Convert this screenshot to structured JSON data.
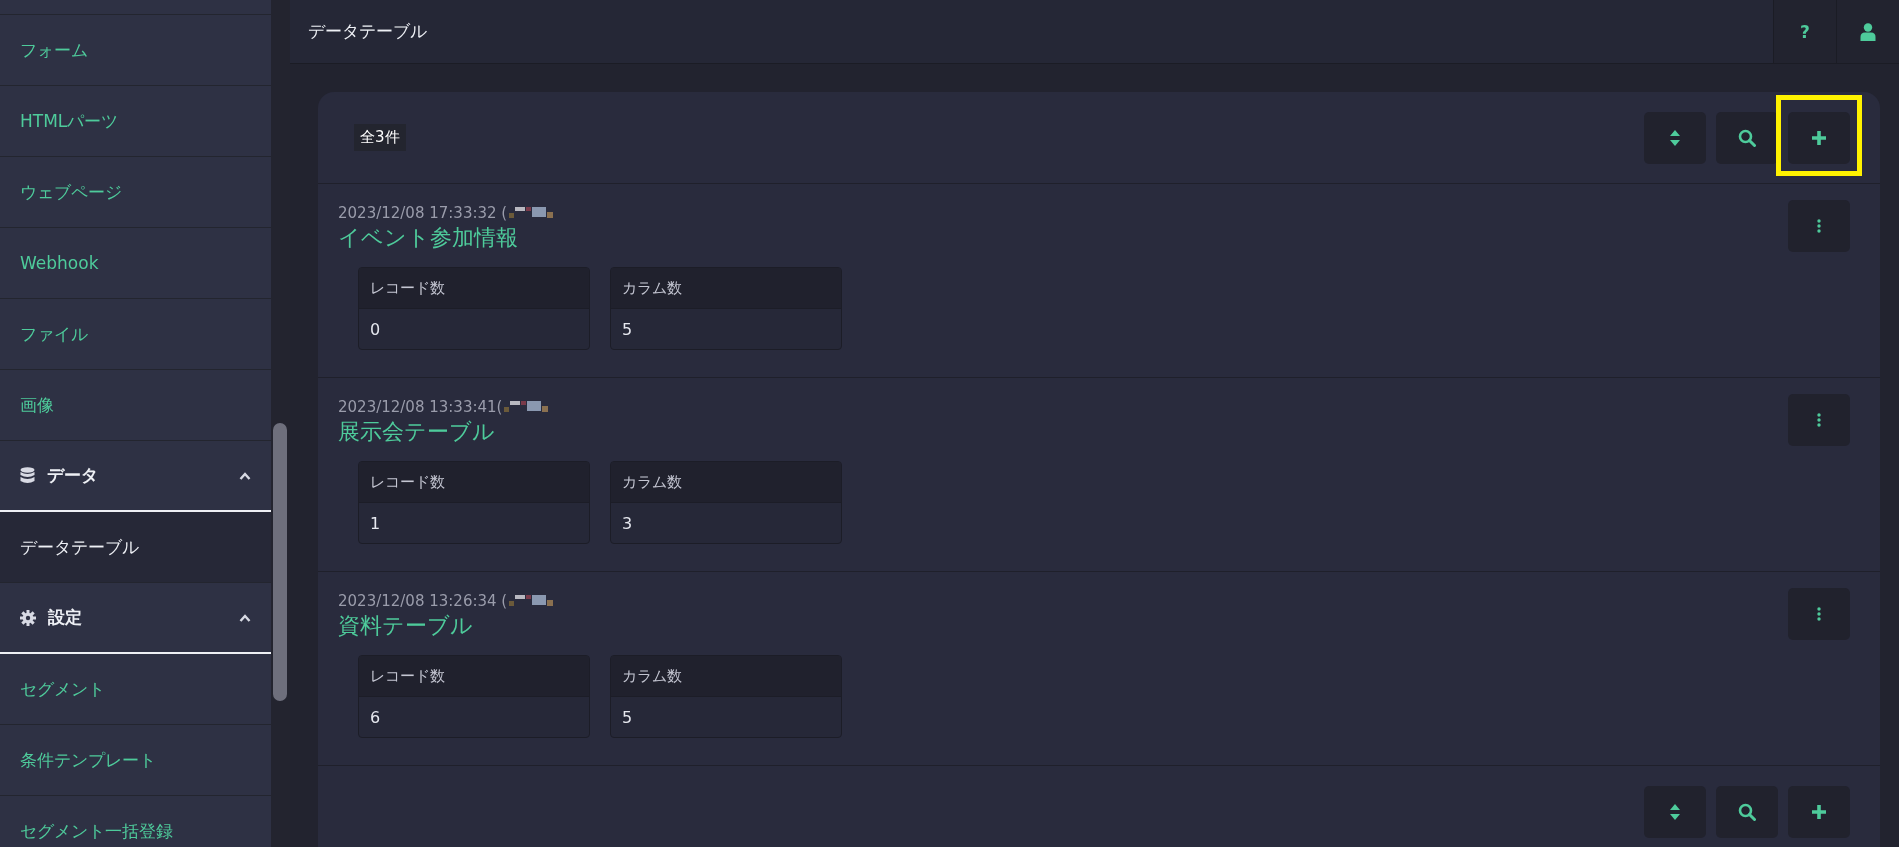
{
  "sidebar": {
    "items": [
      {
        "kind": "link",
        "label": "フォーム",
        "selected": false
      },
      {
        "kind": "link",
        "label": "HTMLパーツ",
        "selected": false
      },
      {
        "kind": "link",
        "label": "ウェブページ",
        "selected": false
      },
      {
        "kind": "link",
        "label": "Webhook",
        "selected": false
      },
      {
        "kind": "link",
        "label": "ファイル",
        "selected": false
      },
      {
        "kind": "link",
        "label": "画像",
        "selected": false
      },
      {
        "kind": "section",
        "label": "データ",
        "expanded": true
      },
      {
        "kind": "link",
        "label": "データテーブル",
        "selected": true
      },
      {
        "kind": "section",
        "label": "設定",
        "expanded": true
      },
      {
        "kind": "link",
        "label": "セグメント",
        "selected": false
      },
      {
        "kind": "link",
        "label": "条件テンプレート",
        "selected": false
      },
      {
        "kind": "link",
        "label": "セグメント一括登録",
        "selected": false
      }
    ]
  },
  "header": {
    "title": "データテーブル",
    "help_label": "?"
  },
  "list": {
    "count": "全3件",
    "add_highlighted": true,
    "records": [
      {
        "timestamp": "2023/12/08 17:33:32 (",
        "title": "イベント参加情報",
        "stats": [
          {
            "label": "レコード数",
            "value": "0"
          },
          {
            "label": "カラム数",
            "value": "5"
          }
        ]
      },
      {
        "timestamp": "2023/12/08 13:33:41(",
        "title": "展示会テーブル",
        "stats": [
          {
            "label": "レコード数",
            "value": "1"
          },
          {
            "label": "カラム数",
            "value": "3"
          }
        ]
      },
      {
        "timestamp": "2023/12/08 13:26:34 (",
        "title": "資料テーブル",
        "stats": [
          {
            "label": "レコード数",
            "value": "6"
          },
          {
            "label": "カラム数",
            "value": "5"
          }
        ]
      }
    ]
  }
}
